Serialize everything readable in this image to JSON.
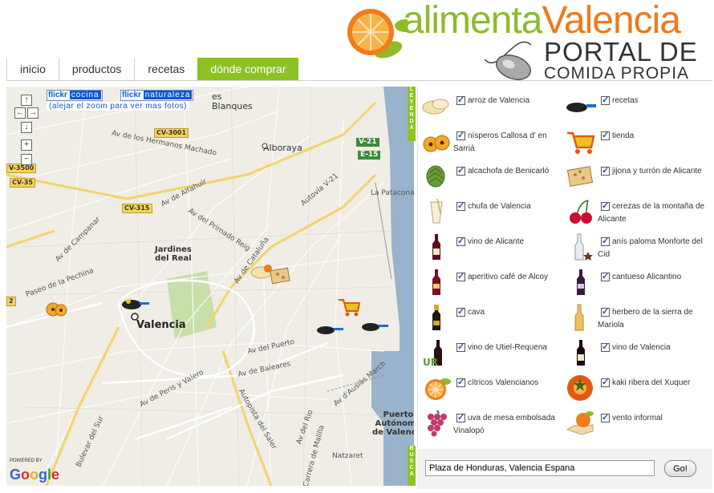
{
  "header": {
    "logo_word_1": "alimenta",
    "logo_word_2": "Valencia",
    "subtitle_1": "PORTAL DE",
    "subtitle_2": "COMIDA PROPIA"
  },
  "nav": {
    "items": [
      {
        "label": "inicio",
        "active": false
      },
      {
        "label": "productos",
        "active": false
      },
      {
        "label": "recetas",
        "active": false
      },
      {
        "label": "dónde comprar",
        "active": true
      }
    ]
  },
  "map": {
    "flickr_brand": "flickr",
    "flickr_1": "cocina",
    "flickr_2": "naturaleza",
    "zoom_note": "(alejar el zoom para ver mas fotos)",
    "side_tab_top": "LEYENDA",
    "side_tab_bottom": "BUSCA",
    "powered": "POWERED BY",
    "google": "Google",
    "labels": {
      "alboraya": "Alboraya",
      "valencia": "Valencia",
      "jardines": "Jardines\ndel Real",
      "patacona": "La Patacona",
      "puerto": "Puerto\nAutónomo\nde Valencia",
      "nazaret": "Natzaret",
      "blanques": "Blanques",
      "es": "es",
      "hermanos": "Av de los Hermanos Machado",
      "alfahuir": "Av de Alfahuir",
      "primado": "Av del Primado Reig",
      "catalunya": "Av de Cataluña",
      "autovia": "Autovía V-21",
      "campanar": "Av de Campanar",
      "pechina": "Paseo de la Pechina",
      "puerto_av": "Av del Puerto",
      "baleares": "Av de Baleares",
      "perisvalero": "Av de Peris y Valero",
      "saler": "Autopista del Saler",
      "ausias": "Av d'Ausiàs March",
      "bulevar": "Bulevar del Sur",
      "carrera": "Carrera de Malilla",
      "rio": "Av del Rio"
    },
    "shields": {
      "cv3001": "CV-3001",
      "cv3500": "V-3500",
      "cv35": "CV-35",
      "cv315": "CV-315",
      "v21": "V-21",
      "e15": "E-15",
      "v2": "2"
    }
  },
  "legend": {
    "items": [
      {
        "label": "arroz de Valencia",
        "icon": "rice-icon"
      },
      {
        "label": "recetas",
        "icon": "pan-icon"
      },
      {
        "label": "nísperos Callosa d' en Sarriá",
        "icon": "loquat-icon"
      },
      {
        "label": "tienda",
        "icon": "cart-icon"
      },
      {
        "label": "alcachofa de Benicarló",
        "icon": "artichoke-icon"
      },
      {
        "label": "jijona y turrón de Alicante",
        "icon": "turron-icon"
      },
      {
        "label": "chufa de Valencia",
        "icon": "horchata-icon"
      },
      {
        "label": "cerezas de la montaña de Alicante",
        "icon": "cherry-icon"
      },
      {
        "label": "vino de Alicante",
        "icon": "wine-bottle-icon"
      },
      {
        "label": "anís paloma Monforte del Cid",
        "icon": "anis-bottle-icon"
      },
      {
        "label": "aperitivo café de Alcoy",
        "icon": "liqueur-bottle-icon"
      },
      {
        "label": "cantueso Alicantino",
        "icon": "cantueso-bottle-icon"
      },
      {
        "label": "cava",
        "icon": "cava-bottle-icon"
      },
      {
        "label": "herbero de la sierra de Mariola",
        "icon": "herbero-bottle-icon"
      },
      {
        "label": "vino de Utiel-Requena",
        "icon": "utiel-bottle-icon"
      },
      {
        "label": "vino de Valencia",
        "icon": "valencia-wine-icon"
      },
      {
        "label": "cítricos Valencianos",
        "icon": "orange-icon"
      },
      {
        "label": "kaki ribera del Xuquer",
        "icon": "kaki-icon"
      },
      {
        "label": "uva de mesa embolsada Vinalopó",
        "icon": "grape-icon"
      },
      {
        "label": "vento informal",
        "icon": "hand-orange-icon"
      }
    ]
  },
  "search": {
    "value": "Plaza de Honduras, Valencia Espana",
    "button": "Go!"
  },
  "colors": {
    "green": "#8dc225",
    "orange": "#ee7a1a"
  }
}
